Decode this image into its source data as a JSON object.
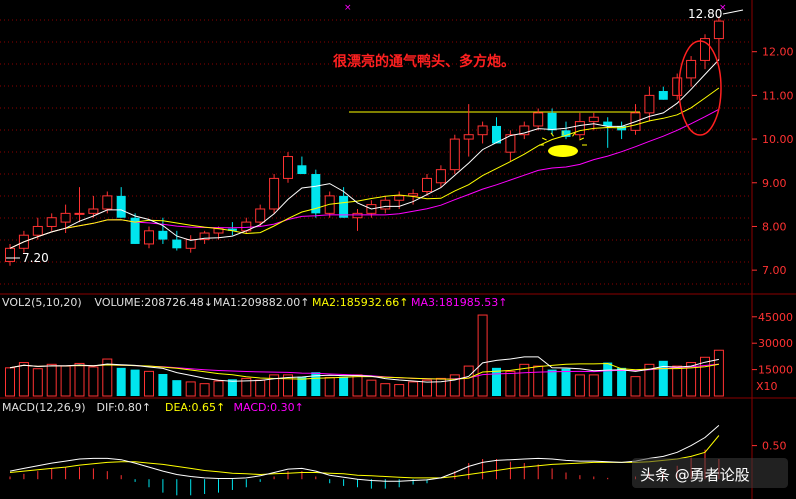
{
  "colors": {
    "up": "#ff3232",
    "down": "#00e5ee",
    "ma5": "#ffffff",
    "ma10": "#ffff00",
    "ma20": "#ff00ff",
    "grid": "#8b0000",
    "axis_text": "#ff3232",
    "annotation_text": "#ff2020",
    "highlight": "#ffff00",
    "circle": "#ff2020"
  },
  "annotation": {
    "text": "很漂亮的通气鸭头、多方炮。",
    "icon": "sun-highlight-icon"
  },
  "watermark": {
    "text": "头条 @勇者论股",
    "icon": "toutiao-logo-icon"
  },
  "chart_data": [
    {
      "type": "candlestick",
      "title": "",
      "ylim": [
        6.5,
        13.0
      ],
      "yticks": [
        "12.00",
        "11.00",
        "10.00",
        "9.00",
        "8.00",
        "7.00"
      ],
      "high_label": "12.80",
      "low_label": "7.20",
      "moving_averages": [
        "MA5",
        "MA10",
        "MA20"
      ],
      "resistance_level": 10.62,
      "ohlc": [
        [
          7.2,
          7.6,
          7.1,
          7.5
        ],
        [
          7.5,
          7.9,
          7.4,
          7.8
        ],
        [
          7.8,
          8.2,
          7.7,
          8.0
        ],
        [
          8.0,
          8.3,
          7.9,
          8.2
        ],
        [
          8.1,
          8.5,
          7.85,
          8.3
        ],
        [
          8.3,
          8.9,
          8.1,
          8.3
        ],
        [
          8.3,
          8.7,
          8.2,
          8.4
        ],
        [
          8.4,
          8.8,
          8.3,
          8.7
        ],
        [
          8.7,
          8.9,
          8.2,
          8.2
        ],
        [
          8.2,
          8.3,
          7.6,
          7.6
        ],
        [
          7.6,
          8.0,
          7.5,
          7.9
        ],
        [
          7.9,
          8.2,
          7.6,
          7.7
        ],
        [
          7.7,
          7.9,
          7.45,
          7.5
        ],
        [
          7.5,
          7.8,
          7.4,
          7.7
        ],
        [
          7.7,
          7.9,
          7.6,
          7.85
        ],
        [
          7.85,
          8.0,
          7.7,
          7.95
        ],
        [
          7.95,
          8.1,
          7.8,
          7.9
        ],
        [
          7.9,
          8.2,
          7.85,
          8.1
        ],
        [
          8.1,
          8.5,
          8.0,
          8.4
        ],
        [
          8.4,
          9.2,
          8.3,
          9.1
        ],
        [
          9.1,
          9.7,
          9.0,
          9.6
        ],
        [
          9.4,
          9.6,
          9.2,
          9.2
        ],
        [
          9.2,
          9.3,
          8.2,
          8.3
        ],
        [
          8.3,
          8.8,
          8.2,
          8.7
        ],
        [
          8.7,
          8.9,
          8.2,
          8.2
        ],
        [
          8.2,
          8.4,
          7.9,
          8.3
        ],
        [
          8.3,
          8.6,
          8.2,
          8.5
        ],
        [
          8.4,
          8.7,
          8.3,
          8.6
        ],
        [
          8.6,
          8.8,
          8.4,
          8.7
        ],
        [
          8.7,
          8.85,
          8.5,
          8.75
        ],
        [
          8.8,
          9.2,
          8.7,
          9.1
        ],
        [
          9.0,
          9.4,
          8.9,
          9.3
        ],
        [
          9.3,
          10.1,
          9.2,
          10.0
        ],
        [
          10.0,
          10.8,
          9.6,
          10.1
        ],
        [
          10.1,
          10.4,
          9.9,
          10.3
        ],
        [
          10.3,
          10.5,
          9.9,
          9.9
        ],
        [
          9.7,
          10.2,
          9.5,
          10.1
        ],
        [
          10.1,
          10.4,
          10.0,
          10.3
        ],
        [
          10.3,
          10.7,
          10.2,
          10.6
        ],
        [
          10.6,
          10.7,
          10.1,
          10.2
        ],
        [
          10.2,
          10.4,
          10.0,
          10.05
        ],
        [
          10.1,
          10.6,
          10.0,
          10.4
        ],
        [
          10.4,
          10.6,
          10.2,
          10.5
        ],
        [
          10.4,
          10.5,
          9.8,
          10.3
        ],
        [
          10.3,
          10.4,
          10.0,
          10.2
        ],
        [
          10.2,
          10.8,
          10.1,
          10.6
        ],
        [
          10.6,
          11.2,
          10.4,
          11.0
        ],
        [
          11.1,
          11.2,
          10.9,
          10.9
        ],
        [
          11.0,
          11.5,
          10.9,
          11.4
        ],
        [
          11.4,
          11.9,
          11.2,
          11.8
        ],
        [
          11.8,
          12.4,
          11.6,
          12.3
        ],
        [
          12.3,
          12.8,
          11.8,
          12.7
        ]
      ]
    },
    {
      "type": "bar",
      "title": "VOL2(5,10,20)",
      "header": [
        {
          "text": "VOL2(5,10,20)",
          "color": "#e0e0e0"
        },
        {
          "text": "VOLUME:208726.48↓",
          "color": "#e0e0e0"
        },
        {
          "text": "MA1:209882.00↑",
          "color": "#e0e0e0"
        },
        {
          "text": "MA2:185932.66↑",
          "color": "#ffff00"
        },
        {
          "text": "MA3:181985.53↑",
          "color": "#ff00ff"
        }
      ],
      "yticks": [
        "45000",
        "30000",
        "15000"
      ],
      "unit_label": "X10",
      "ylim": [
        0,
        50000
      ],
      "values": [
        16000,
        19000,
        15500,
        18000,
        17000,
        18500,
        16500,
        21000,
        16000,
        15000,
        14000,
        12500,
        9000,
        8000,
        7000,
        8500,
        9500,
        10000,
        9000,
        12000,
        12000,
        11000,
        13500,
        10500,
        11000,
        12000,
        9000,
        7000,
        6500,
        8000,
        9000,
        10000,
        12000,
        17000,
        46000,
        16000,
        14000,
        18000,
        17000,
        15000,
        15500,
        12000,
        12000,
        19000,
        16000,
        11000,
        18000,
        20000,
        17000,
        19000,
        22000,
        26000
      ]
    },
    {
      "type": "line",
      "title": "MACD(12,26,9)",
      "header": [
        {
          "text": "MACD(12,26,9)",
          "color": "#e0e0e0"
        },
        {
          "text": "DIF:0.80↑",
          "color": "#e0e0e0"
        },
        {
          "text": "DEA:0.65↑",
          "color": "#ffff00"
        },
        {
          "text": "MACD:0.30↑",
          "color": "#ff00ff"
        }
      ],
      "yticks": [
        "0.50"
      ],
      "ylim": [
        -0.25,
        1.0
      ],
      "series": [
        {
          "name": "DIF",
          "values": [
            0.12,
            0.16,
            0.2,
            0.24,
            0.27,
            0.3,
            0.31,
            0.31,
            0.29,
            0.24,
            0.18,
            0.12,
            0.07,
            0.04,
            0.02,
            0.01,
            0.01,
            0.02,
            0.05,
            0.1,
            0.15,
            0.16,
            0.12,
            0.06,
            0.03,
            0.0,
            -0.02,
            -0.03,
            -0.03,
            -0.02,
            -0.01,
            0.02,
            0.1,
            0.19,
            0.25,
            0.28,
            0.29,
            0.3,
            0.31,
            0.3,
            0.28,
            0.27,
            0.27,
            0.26,
            0.25,
            0.27,
            0.31,
            0.34,
            0.4,
            0.5,
            0.62,
            0.8
          ]
        },
        {
          "name": "DEA",
          "values": [
            0.1,
            0.12,
            0.14,
            0.16,
            0.18,
            0.21,
            0.23,
            0.25,
            0.26,
            0.26,
            0.24,
            0.22,
            0.19,
            0.16,
            0.13,
            0.11,
            0.09,
            0.08,
            0.07,
            0.08,
            0.09,
            0.1,
            0.1,
            0.09,
            0.08,
            0.06,
            0.05,
            0.04,
            0.03,
            0.02,
            0.02,
            0.02,
            0.04,
            0.07,
            0.1,
            0.13,
            0.16,
            0.18,
            0.2,
            0.22,
            0.23,
            0.24,
            0.25,
            0.25,
            0.25,
            0.25,
            0.26,
            0.28,
            0.3,
            0.34,
            0.4,
            0.65
          ]
        }
      ]
    }
  ]
}
